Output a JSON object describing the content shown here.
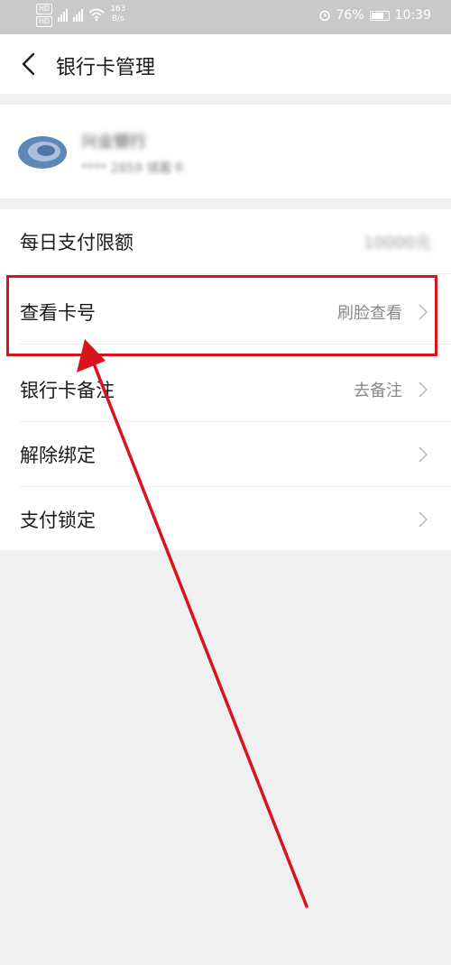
{
  "status_bar": {
    "hd_badge_1": "HD",
    "hd_badge_2": "HD",
    "net_speed_value": "163",
    "net_speed_unit": "B/s",
    "battery": "76%",
    "battery_level": 0.76,
    "time": "10:39"
  },
  "header": {
    "title": "银行卡管理"
  },
  "card": {
    "bank_name": "兴业银行",
    "card_info": "**** 2859  储蓄卡"
  },
  "settings": [
    {
      "label": "每日支付限额",
      "value": "10000元"
    },
    {
      "label": "查看卡号",
      "value": "刷脸查看"
    },
    {
      "label": "银行卡备注",
      "value": "去备注"
    },
    {
      "label": "解除绑定",
      "value": ""
    },
    {
      "label": "支付锁定",
      "value": ""
    }
  ],
  "annotation_color": "#d8141c"
}
